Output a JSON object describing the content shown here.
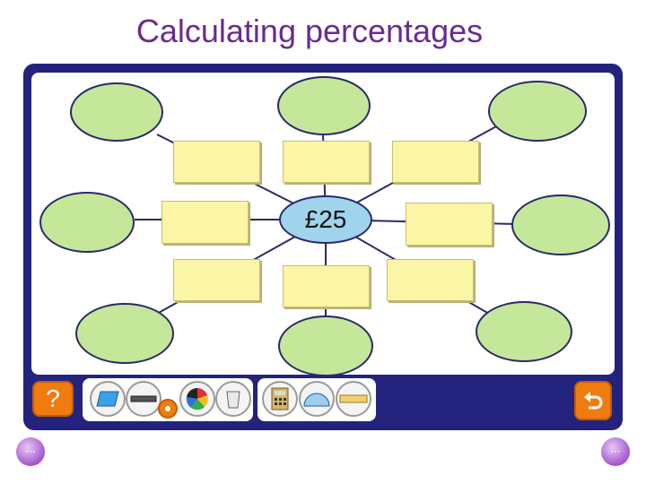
{
  "header": {
    "title": "Calculating percentages"
  },
  "centre": {
    "value": "£25"
  },
  "toolbar": {
    "help_label": "?",
    "tools": [
      "shape-tool-icon",
      "ruler-tool-icon",
      "pen-tool-icon",
      "colour-wheel-icon",
      "bin-icon",
      "calculator-icon",
      "protractor-icon",
      "measuring-tape-icon"
    ],
    "undo_icon": "undo-icon"
  },
  "nav": {
    "prev_label": "···",
    "next_label": "···"
  },
  "colors": {
    "title": "#6b2a8f",
    "frame": "#23237e",
    "ellipse": "#c5e79a",
    "box": "#fbf6a6",
    "centre": "#9fd4ec",
    "button": "#f07c10"
  }
}
